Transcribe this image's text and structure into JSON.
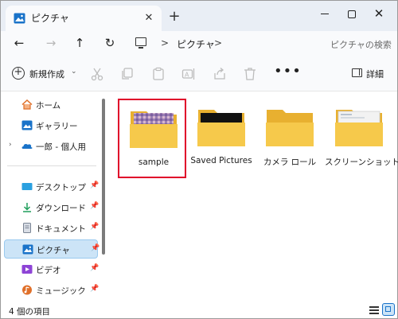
{
  "window": {
    "tab_title": "ピクチャ",
    "tab_close_glyph": "✕",
    "new_tab_glyph": "+",
    "close_glyph": "✕"
  },
  "address": {
    "back_glyph": "←",
    "forward_glyph": "→",
    "up_glyph": "↑",
    "refresh_glyph": "↻",
    "separator": ">",
    "crumb": "ピクチャ",
    "search_placeholder": "ピクチャの検索"
  },
  "commandbar": {
    "new_label": "新規作成",
    "new_chevron": "⌄",
    "more_glyph": "•••",
    "details_label": "詳細"
  },
  "sidebar": {
    "items": [
      {
        "label": "ホーム",
        "icon": "home-icon"
      },
      {
        "label": "ギャラリー",
        "icon": "gallery-icon"
      },
      {
        "label": "一郎 - 個人用",
        "icon": "onedrive-icon",
        "expand": "›"
      },
      {
        "label": "デスクトップ",
        "icon": "desktop-icon",
        "pinned": true
      },
      {
        "label": "ダウンロード",
        "icon": "download-icon",
        "pinned": true
      },
      {
        "label": "ドキュメント",
        "icon": "document-icon",
        "pinned": true
      },
      {
        "label": "ピクチャ",
        "icon": "pictures-icon",
        "pinned": true,
        "selected": true
      },
      {
        "label": "ビデオ",
        "icon": "video-icon",
        "pinned": true
      },
      {
        "label": "ミュージック",
        "icon": "music-icon",
        "pinned": true
      }
    ],
    "pin_glyph": "📌"
  },
  "content": {
    "folders": [
      {
        "name": "sample",
        "preview": "photo",
        "highlighted": true
      },
      {
        "name": "Saved Pictures",
        "preview": "dark"
      },
      {
        "name": "カメラ ロール",
        "preview": "empty"
      },
      {
        "name": "スクリーンショット",
        "preview": "screenshot"
      }
    ]
  },
  "status": {
    "item_count": "4 個の項目"
  },
  "colors": {
    "accent": "#1a73c9",
    "folder": "#f6c94b",
    "folder_dark": "#e8b030",
    "highlight_border": "#e0002a",
    "selected_bg": "#cce4f7"
  }
}
